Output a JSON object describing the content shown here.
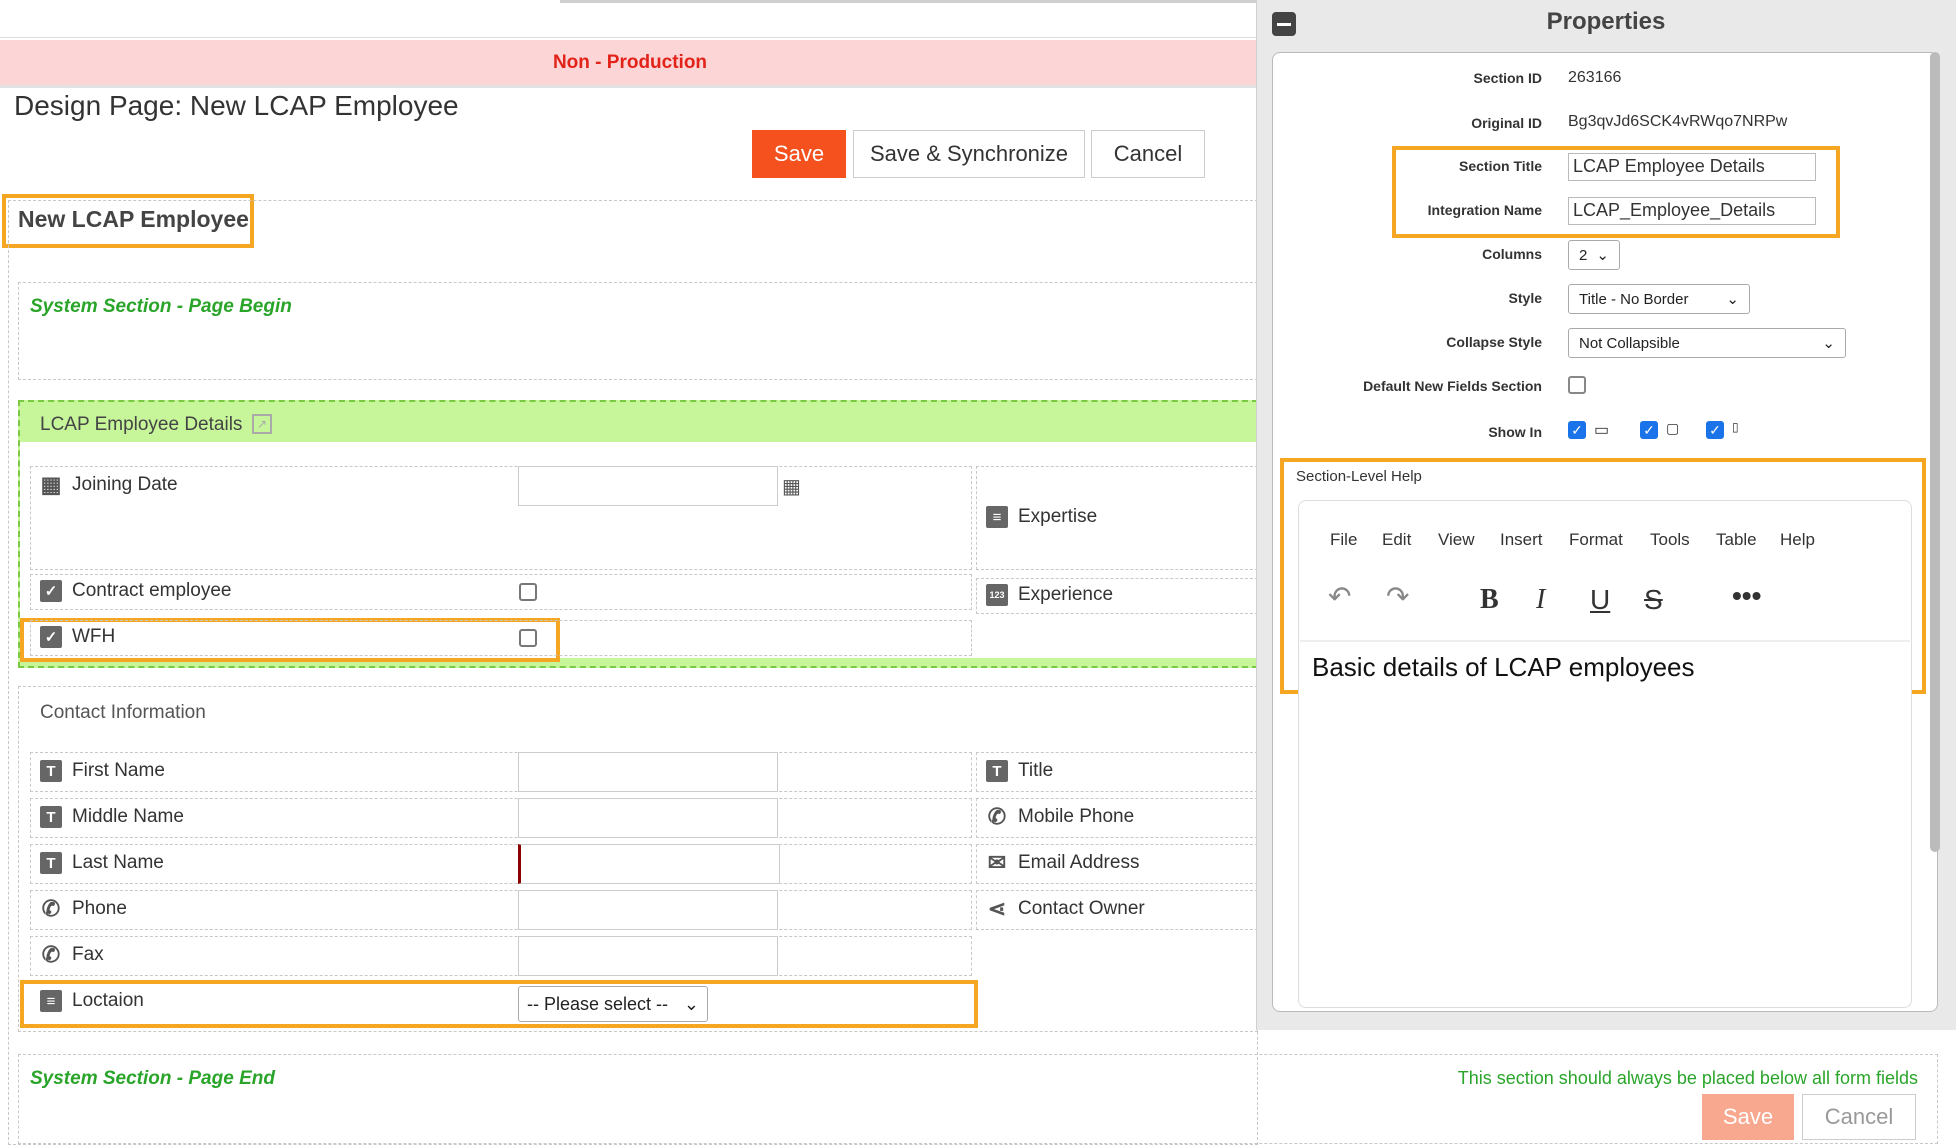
{
  "banner": {
    "text": "Non - Production"
  },
  "page": {
    "title": "Design Page: New LCAP Employee"
  },
  "toolbar": {
    "save_label": "Save",
    "sync_label": "Save & Synchronize",
    "cancel_label": "Cancel"
  },
  "form": {
    "name": "New LCAP Employee",
    "system_begin": "System Section - Page Begin",
    "system_end": "System Section - Page End",
    "system_end_note": "This section should always be placed below all form fields",
    "bottom_save": "Save",
    "bottom_cancel": "Cancel"
  },
  "section1": {
    "title": "LCAP Employee Details",
    "fields": {
      "joining_date": "Joining Date",
      "contract": "Contract employee",
      "wfh": "WFH",
      "expertise": "Expertise",
      "experience": "Experience"
    }
  },
  "section2": {
    "title": "Contact Information",
    "fields": {
      "first_name": "First Name",
      "middle_name": "Middle Name",
      "last_name": "Last Name",
      "phone": "Phone",
      "fax": "Fax",
      "location": "Loctaion",
      "location_select": "-- Please select --",
      "title": "Title",
      "mobile": "Mobile Phone",
      "email": "Email Address",
      "owner": "Contact Owner"
    }
  },
  "properties": {
    "title": "Properties",
    "section_id_label": "Section ID",
    "section_id": "263166",
    "original_id_label": "Original ID",
    "original_id": "Bg3qvJd6SCK4vRWqo7NRPw",
    "section_title_label": "Section Title",
    "section_title": "LCAP Employee Details",
    "integration_name_label": "Integration Name",
    "integration_name": "LCAP_Employee_Details",
    "columns_label": "Columns",
    "columns": "2",
    "style_label": "Style",
    "style": "Title - No Border",
    "collapse_label": "Collapse Style",
    "collapse": "Not Collapsible",
    "default_new_label": "Default New Fields Section",
    "default_new_checked": false,
    "show_in_label": "Show In",
    "help_label": "Section-Level Help",
    "editor_menu": [
      "File",
      "Edit",
      "View",
      "Insert",
      "Format",
      "Tools",
      "Table",
      "Help"
    ],
    "help_text": "Basic details of LCAP employees"
  },
  "colors": {
    "accent": "#f4511e",
    "highlight": "#f5a623",
    "system_green": "#2aa52a",
    "section_green": "#c6f59a",
    "banner_bg": "#fcd6d6",
    "banner_text": "#e2231a"
  }
}
